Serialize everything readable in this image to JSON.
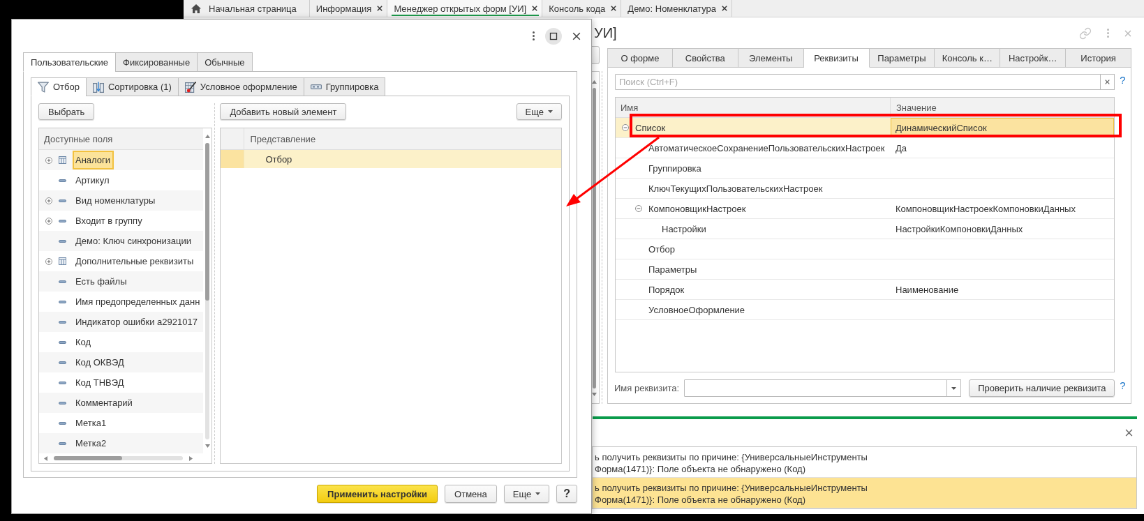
{
  "app_tabs": [
    {
      "label": "Начальная страница",
      "kind": "home",
      "selected": false
    },
    {
      "label": "Информация",
      "kind": "page",
      "selected": false
    },
    {
      "label": "Менеджер открытых форм [УИ]",
      "kind": "page",
      "selected": true
    },
    {
      "label": "Консоль кода",
      "kind": "page",
      "selected": false
    },
    {
      "label": "Демо: Номенклатура",
      "kind": "page",
      "selected": false
    }
  ],
  "form": {
    "title": "УИ]",
    "tabs": [
      {
        "label": "О форме",
        "selected": false
      },
      {
        "label": "Свойства",
        "selected": false
      },
      {
        "label": "Элементы",
        "selected": false
      },
      {
        "label": "Реквизиты",
        "selected": true
      },
      {
        "label": "Параметры",
        "selected": false
      },
      {
        "label": "Консоль к…",
        "selected": false
      },
      {
        "label": "Настройк…",
        "selected": false
      },
      {
        "label": "История",
        "selected": false
      }
    ],
    "search": {
      "placeholder": "Поиск (Ctrl+F)",
      "help": "?"
    },
    "table": {
      "columns": [
        "Имя",
        "Значение"
      ],
      "rows": [
        {
          "name": "Список",
          "value": "ДинамическийСписок",
          "selected": true,
          "expanded": true,
          "children": [
            {
              "name": "АвтоматическоеСохранениеПользовательскихНастроек",
              "value": "Да",
              "selected": false
            },
            {
              "name": "Группировка",
              "selected": false
            },
            {
              "name": "КлючТекущихПользовательскихНастроек",
              "selected": false
            },
            {
              "name": "КомпоновщикНастроек",
              "value": "КомпоновщикНастроекКомпоновкиДанных",
              "selected": false,
              "expanded": true,
              "children": [
                {
                  "name": "Настройки",
                  "value": "НастройкиКомпоновкиДанных",
                  "selected": false
                }
              ]
            },
            {
              "name": "Отбор",
              "selected": false
            },
            {
              "name": "Параметры",
              "selected": false
            },
            {
              "name": "Порядок",
              "value": "Наименование",
              "selected": false
            },
            {
              "name": "УсловноеОформление",
              "selected": false
            }
          ]
        }
      ]
    },
    "attribute": {
      "label": "Имя реквизита:",
      "button": "Проверить наличие реквизита",
      "help": "?"
    }
  },
  "messages": [
    {
      "text": "ь получить реквизиты по причине: {УниверсальныеИнструменты\nФорма(1471)}: Поле объекта не обнаружено (Код)",
      "selected": false
    },
    {
      "text": "ь получить реквизиты по причине: {УниверсальныеИнструменты\nФорма(1471)}: Поле объекта не обнаружено (Код)",
      "selected": true
    }
  ],
  "dialog": {
    "tabs": [
      {
        "label": "Пользовательские",
        "selected": true
      },
      {
        "label": "Фиксированные",
        "selected": false
      },
      {
        "label": "Обычные",
        "selected": false
      }
    ],
    "subtabs": [
      {
        "label": "Отбор",
        "kind": "filter",
        "selected": true
      },
      {
        "label": "Сортировка (1)",
        "kind": "sort",
        "selected": false
      },
      {
        "label": "Условное оформление",
        "kind": "appearance",
        "selected": false
      },
      {
        "label": "Группировка",
        "kind": "grouping",
        "selected": false
      }
    ],
    "select_button": "Выбрать",
    "fields": {
      "header": "Доступные поля",
      "items": [
        {
          "label": "Аналоги",
          "kind": "table",
          "expanded": false,
          "selected": true
        },
        {
          "label": "Артикул",
          "kind": "field",
          "selected": false
        },
        {
          "label": "Вид номенклатуры",
          "kind": "field",
          "expanded": false,
          "selected": false
        },
        {
          "label": "Входит в группу",
          "kind": "field",
          "expanded": false,
          "selected": false
        },
        {
          "label": "Демо: Ключ синхронизации",
          "kind": "field",
          "selected": false
        },
        {
          "label": "Дополнительные реквизиты",
          "kind": "table",
          "expanded": false,
          "selected": false
        },
        {
          "label": "Есть файлы",
          "kind": "field",
          "selected": false
        },
        {
          "label": "Имя предопределенных данн",
          "kind": "field",
          "selected": false
        },
        {
          "label": "Индикатор ошибки a2921017",
          "kind": "field",
          "selected": false
        },
        {
          "label": "Код",
          "kind": "field",
          "selected": false
        },
        {
          "label": "Код ОКВЭД",
          "kind": "field",
          "selected": false
        },
        {
          "label": "Код ТНВЭД",
          "kind": "field",
          "selected": false
        },
        {
          "label": "Комментарий",
          "kind": "field",
          "selected": false
        },
        {
          "label": "Метка1",
          "kind": "field",
          "selected": false
        },
        {
          "label": "Метка2",
          "kind": "field",
          "selected": false
        }
      ]
    },
    "add_button": "Добавить новый элемент",
    "more_button": "Еще",
    "filter_table": {
      "column": "Представление",
      "rows": [
        {
          "label": "Отбор",
          "selected": true
        }
      ]
    },
    "footer": {
      "apply": "Применить настройки",
      "cancel": "Отмена",
      "more": "Еще",
      "help": "?"
    }
  }
}
